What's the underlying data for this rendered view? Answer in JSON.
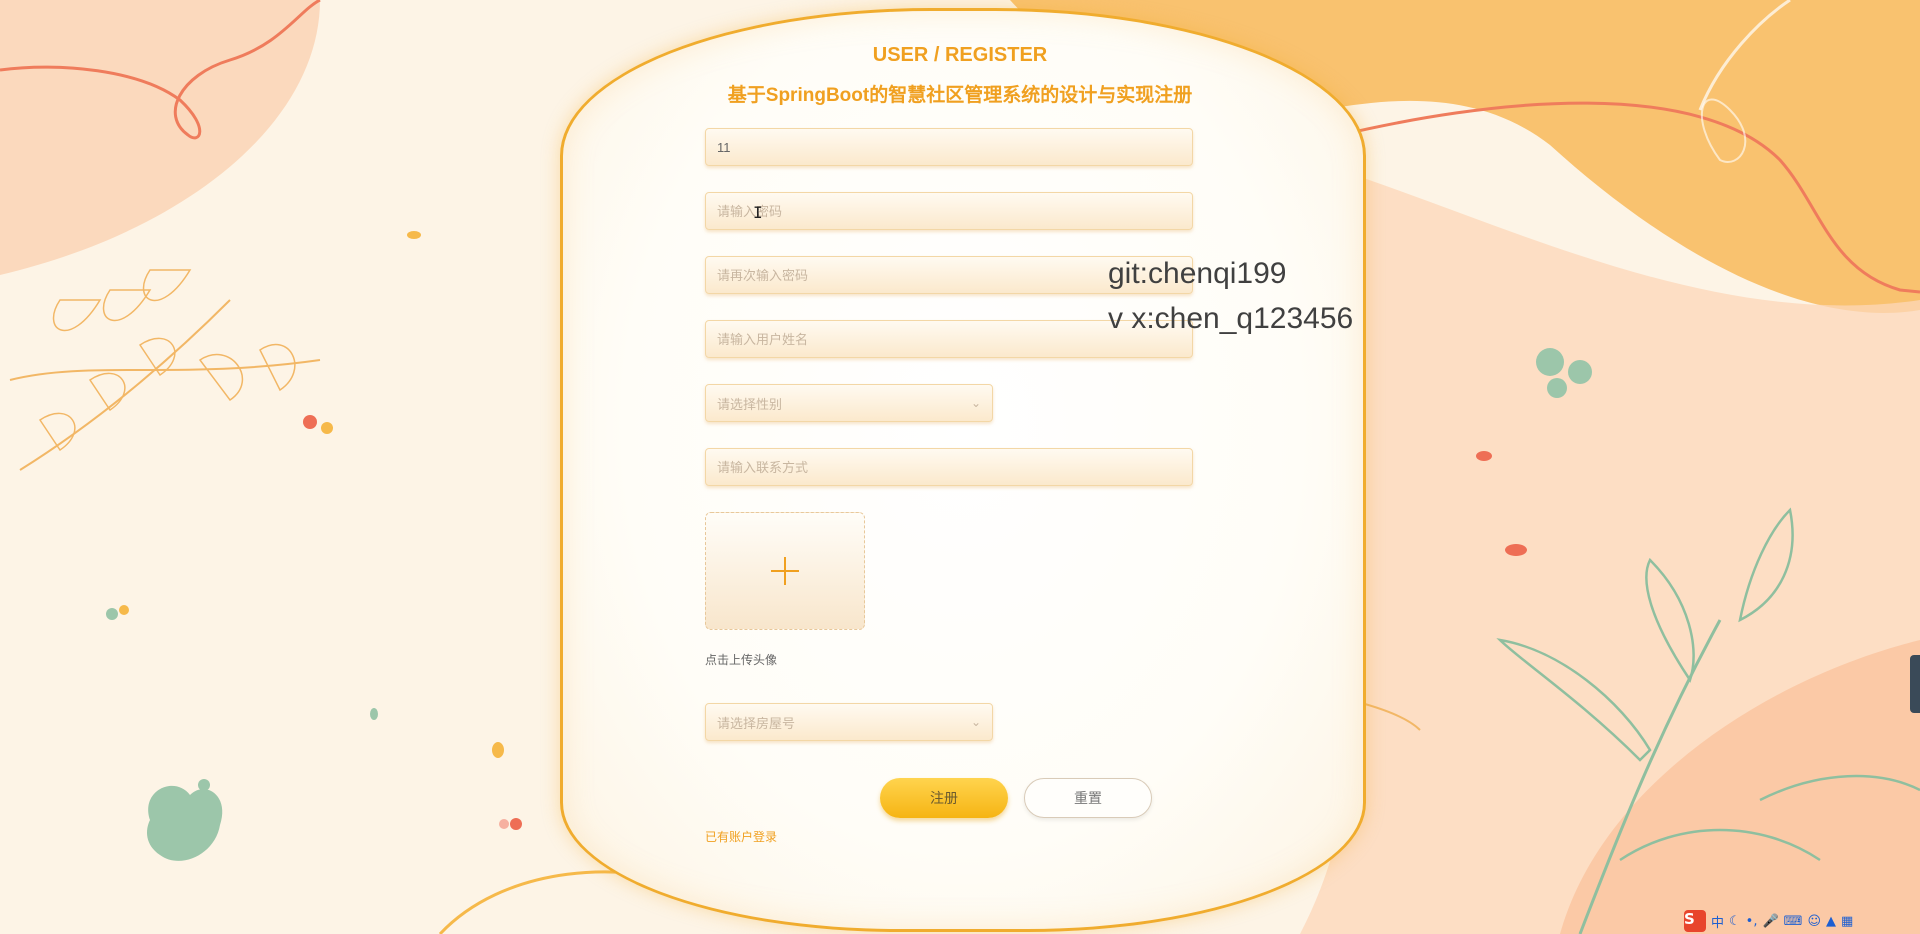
{
  "title": "USER / REGISTER",
  "subtitle": "基于SpringBoot的智慧社区管理系统的设计与实现注册",
  "form": {
    "username": {
      "value": "11",
      "placeholder": ""
    },
    "password": {
      "placeholder": "请输入密码"
    },
    "password_confirm": {
      "placeholder": "请再次输入密码"
    },
    "name": {
      "placeholder": "请输入用户姓名"
    },
    "gender": {
      "placeholder": "请选择性别"
    },
    "phone": {
      "placeholder": "请输入联系方式"
    },
    "avatar_label": "点击上传头像",
    "house": {
      "placeholder": "请选择房屋号"
    }
  },
  "buttons": {
    "register": "注册",
    "reset": "重置"
  },
  "login_link": "已有账户登录",
  "watermark": {
    "line1": "git:chenqi199",
    "line2": "v x:chen_q123456"
  },
  "tray": {
    "logo": "S",
    "ime_mode": "中",
    "icons": [
      "moon-icon",
      "dot-icon",
      "microphone-icon",
      "keyboard-icon",
      "user-icon",
      "shirt-icon",
      "grid-icon"
    ]
  },
  "colors": {
    "accent": "#f0a020",
    "card_border": "#f0ac2e",
    "button_yellow": "#f6b413"
  }
}
